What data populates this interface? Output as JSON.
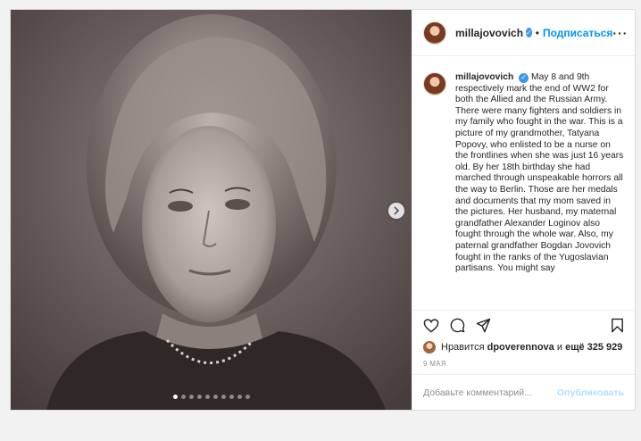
{
  "post": {
    "username": "millajovovich",
    "separator": "•",
    "follow_label": "Подписаться",
    "more_label": "···",
    "caption": "May 8 and 9th respectively mark the end of WW2 for both the Allied and the Russian Army. There were many fighters and soldiers in my family who fought in the war. This is a picture of my grandmother, Tatyana Popovy, who enlisted to be a nurse on the frontlines when she was just 16 years old. By her 18th birthday she had marched through unspeakable horrors all the way to Berlin. Those are her medals and documents that my mom saved in the pictures. Her husband, my maternal grandfather Alexander Loginov also fought through the whole war. Also, my paternal grandfather Bogdan Jovovich fought in the ranks of the Yugoslavian partisans. You might say",
    "carousel": {
      "slides": 10,
      "active_index": 0
    },
    "likes": {
      "prefix": "Нравится",
      "liker": "dpoverennova",
      "conjunction": "и",
      "others": "ещё 325 929"
    },
    "date": "9 МАЯ",
    "comment": {
      "placeholder": "Добавьте комментарий...",
      "publish_label": "Опубликовать"
    },
    "icons": {
      "like": "heart-icon",
      "comment": "comment-icon",
      "share": "share-icon",
      "save": "bookmark-icon",
      "next": "chevron-right-icon",
      "verified": "verified-badge-icon"
    },
    "colors": {
      "link_blue": "#0095f6",
      "verified_blue": "#3897f0",
      "publish_disabled": "#b2dffc",
      "muted": "#8e8e8e"
    }
  }
}
